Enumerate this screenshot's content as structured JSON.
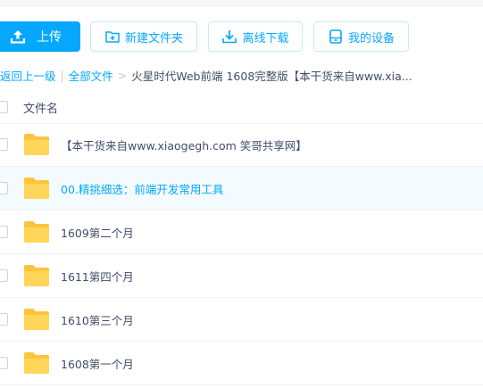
{
  "toolbar": {
    "upload_label": "上传",
    "new_folder_label": "新建文件夹",
    "offline_download_label": "离线下载",
    "my_devices_label": "我的设备",
    "accent_color": "#06a7ff"
  },
  "breadcrumb": {
    "back_label": "返回上一级",
    "separator_bar": "|",
    "all_files_label": "全部文件",
    "separator_arrow": ">",
    "current_folder": "火星时代Web前端 1608完整版【本干货来自www.xia..."
  },
  "list": {
    "column_name_header": "文件名",
    "items": [
      {
        "name": "【本干货来自www.xiaogegh.com 笑哥共享网】",
        "icon": "folder-icon"
      },
      {
        "name": "00.精挑细选：前端开发常用工具",
        "icon": "folder-icon"
      },
      {
        "name": "1609第二个月",
        "icon": "folder-icon"
      },
      {
        "name": "1611第四个月",
        "icon": "folder-icon"
      },
      {
        "name": "1610第三个月",
        "icon": "folder-icon"
      },
      {
        "name": "1608第一个月",
        "icon": "folder-icon"
      }
    ]
  }
}
